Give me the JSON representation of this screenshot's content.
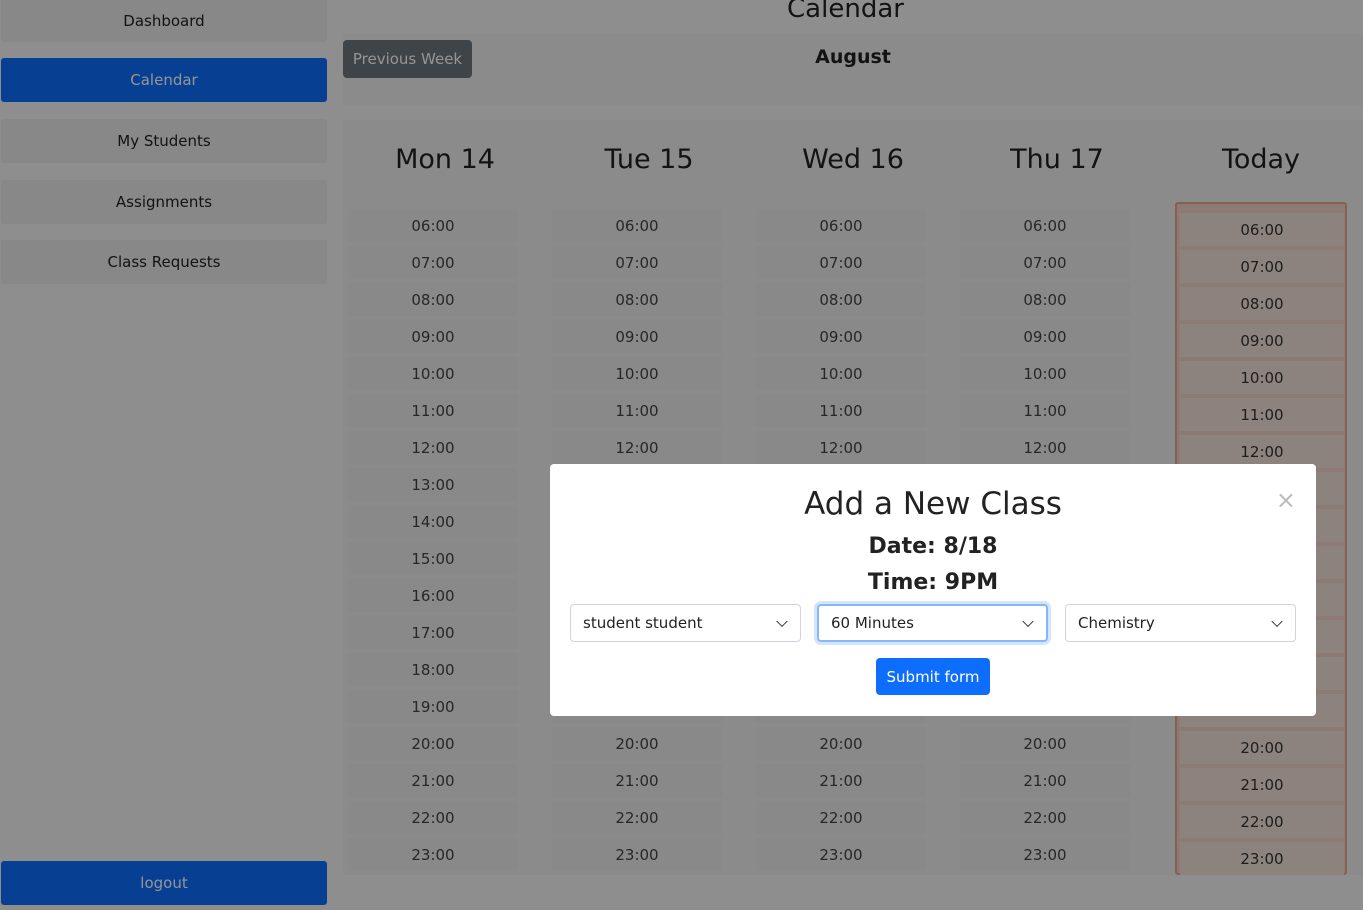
{
  "sidebar": {
    "items": [
      {
        "label": "Dashboard",
        "active": false
      },
      {
        "label": "Calendar",
        "active": true
      },
      {
        "label": "My Students",
        "active": false
      },
      {
        "label": "Assignments",
        "active": false
      },
      {
        "label": "Class Requests",
        "active": false
      }
    ],
    "logout_label": "logout"
  },
  "header": {
    "title": "Calendar",
    "month": "August",
    "prev_week_label": "Previous Week"
  },
  "calendar": {
    "days": [
      {
        "label": "Mon 14",
        "today": false
      },
      {
        "label": "Tue 15",
        "today": false
      },
      {
        "label": "Wed 16",
        "today": false
      },
      {
        "label": "Thu 17",
        "today": false
      },
      {
        "label": "Today",
        "today": true
      }
    ],
    "times": [
      "06:00",
      "07:00",
      "08:00",
      "09:00",
      "10:00",
      "11:00",
      "12:00",
      "13:00",
      "14:00",
      "15:00",
      "16:00",
      "17:00",
      "18:00",
      "19:00",
      "20:00",
      "21:00",
      "22:00",
      "23:00"
    ]
  },
  "modal": {
    "title": "Add a New Class",
    "date_text": "Date: 8/18",
    "time_text": "Time: 9PM",
    "close_glyph": "×",
    "student_select": {
      "value": "student student"
    },
    "duration_select": {
      "value": "60 Minutes"
    },
    "subject_select": {
      "value": "Chemistry"
    },
    "submit_label": "Submit form"
  },
  "colors": {
    "primary": "#0d6efd",
    "secondary": "#6c757d",
    "today_border": "#e8a88a"
  }
}
